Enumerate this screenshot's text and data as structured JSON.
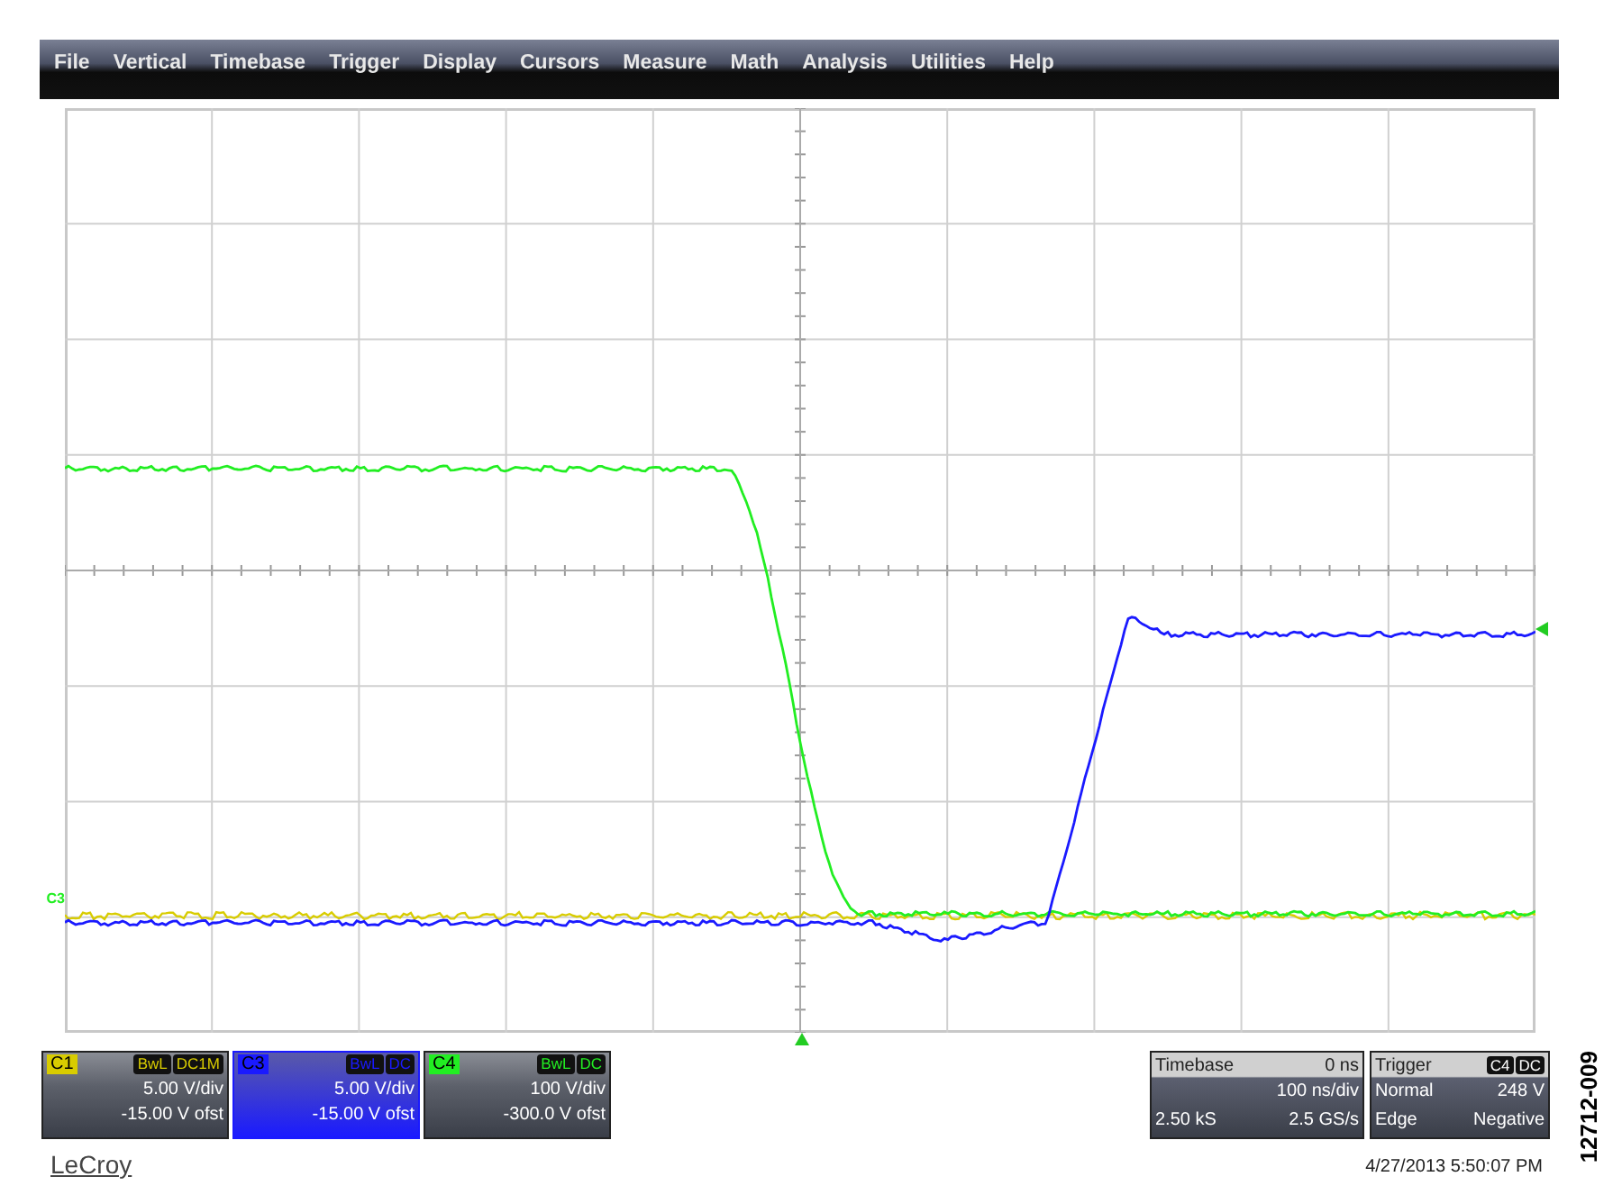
{
  "menu": [
    {
      "label": "File"
    },
    {
      "label": "Vertical"
    },
    {
      "label": "Timebase"
    },
    {
      "label": "Trigger"
    },
    {
      "label": "Display"
    },
    {
      "label": "Cursors"
    },
    {
      "label": "Measure"
    },
    {
      "label": "Math"
    },
    {
      "label": "Analysis"
    },
    {
      "label": "Utilities"
    },
    {
      "label": "Help"
    }
  ],
  "trace_marker": {
    "label": "C3"
  },
  "channels": [
    {
      "label": "C1",
      "color": "#d8cc00",
      "bandwidth": "BwL",
      "coupling": "DC1M",
      "scale": "5.00 V/div",
      "offset": "-15.00 V ofst",
      "selected": false
    },
    {
      "label": "C3",
      "color": "#1a1aff",
      "bandwidth": "BwL",
      "coupling": "DC",
      "scale": "5.00 V/div",
      "offset": "-15.00 V ofst",
      "selected": true
    },
    {
      "label": "C4",
      "color": "#22ee22",
      "bandwidth": "BwL",
      "coupling": "DC",
      "scale": "100 V/div",
      "offset": "-300.0 V ofst",
      "selected": false
    }
  ],
  "timebase": {
    "title": "Timebase",
    "delay": "0 ns",
    "scale": "100 ns/div",
    "samples": "2.50 kS",
    "rate": "2.5 GS/s"
  },
  "trigger": {
    "title": "Trigger",
    "source": "C4",
    "coupling": "DC",
    "mode": "Normal",
    "level": "248 V",
    "type": "Edge",
    "slope": "Negative"
  },
  "logo": "LeCroy",
  "timestamp": "4/27/2013 5:50:07 PM",
  "figure_id": "12712-009"
}
